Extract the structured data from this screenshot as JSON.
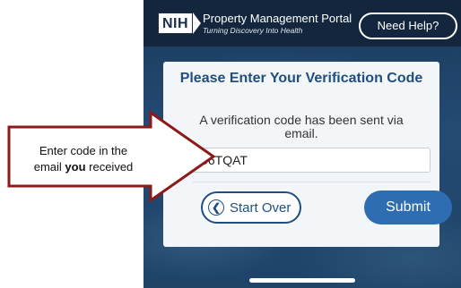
{
  "header": {
    "logo_text": "NIH",
    "title": "Property Management Portal",
    "subtitle": "Turning Discovery Into Health",
    "help_button": "Need Help?"
  },
  "card": {
    "title": "Please Enter Your Verification Code",
    "message": "A verification code has been sent via email.",
    "code_value": "G6TQAT",
    "start_over_label": "Start Over",
    "submit_label": "Submit"
  },
  "callout": {
    "line1": "Enter code in the",
    "line2_before": "email ",
    "line2_bold": "you",
    "line2_after": " received"
  },
  "icons": {
    "back": "chevron-left-icon"
  },
  "colors": {
    "header_bg": "#13263d",
    "screen_bg": "#244a73",
    "card_title": "#1f4f82",
    "submit_bg": "#2e6db1",
    "callout_border": "#8b1a1a"
  }
}
